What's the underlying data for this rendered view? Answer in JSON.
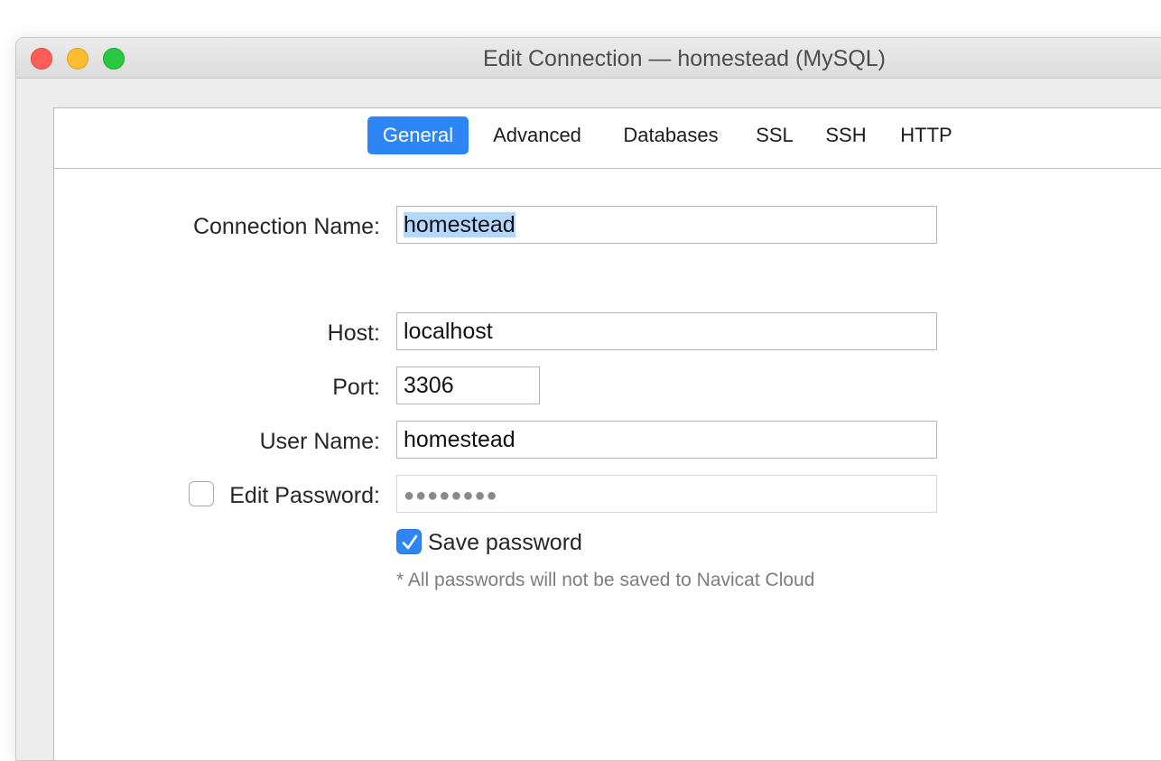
{
  "window": {
    "title": "Edit Connection — homestead (MySQL)"
  },
  "tabs": [
    {
      "label": "General",
      "active": true
    },
    {
      "label": "Advanced",
      "active": false
    },
    {
      "label": "Databases",
      "active": false
    },
    {
      "label": "SSL",
      "active": false
    },
    {
      "label": "SSH",
      "active": false
    },
    {
      "label": "HTTP",
      "active": false
    }
  ],
  "form": {
    "connection_name": {
      "label": "Connection Name:",
      "value": "homestead"
    },
    "host": {
      "label": "Host:",
      "value": "localhost"
    },
    "port": {
      "label": "Port:",
      "value": "3306"
    },
    "user_name": {
      "label": "User Name:",
      "value": "homestead"
    },
    "edit_password": {
      "label": "Edit Password:",
      "checked": false,
      "value": "●●●●●●●●"
    },
    "save_password": {
      "label": "Save password",
      "checked": true
    },
    "note": "* All passwords will not be saved to Navicat Cloud"
  },
  "colors": {
    "accent": "#2e86f5",
    "selection": "#b3d7ff",
    "close": "#fe5f57",
    "minimize": "#febc2e",
    "zoom": "#28c840"
  }
}
